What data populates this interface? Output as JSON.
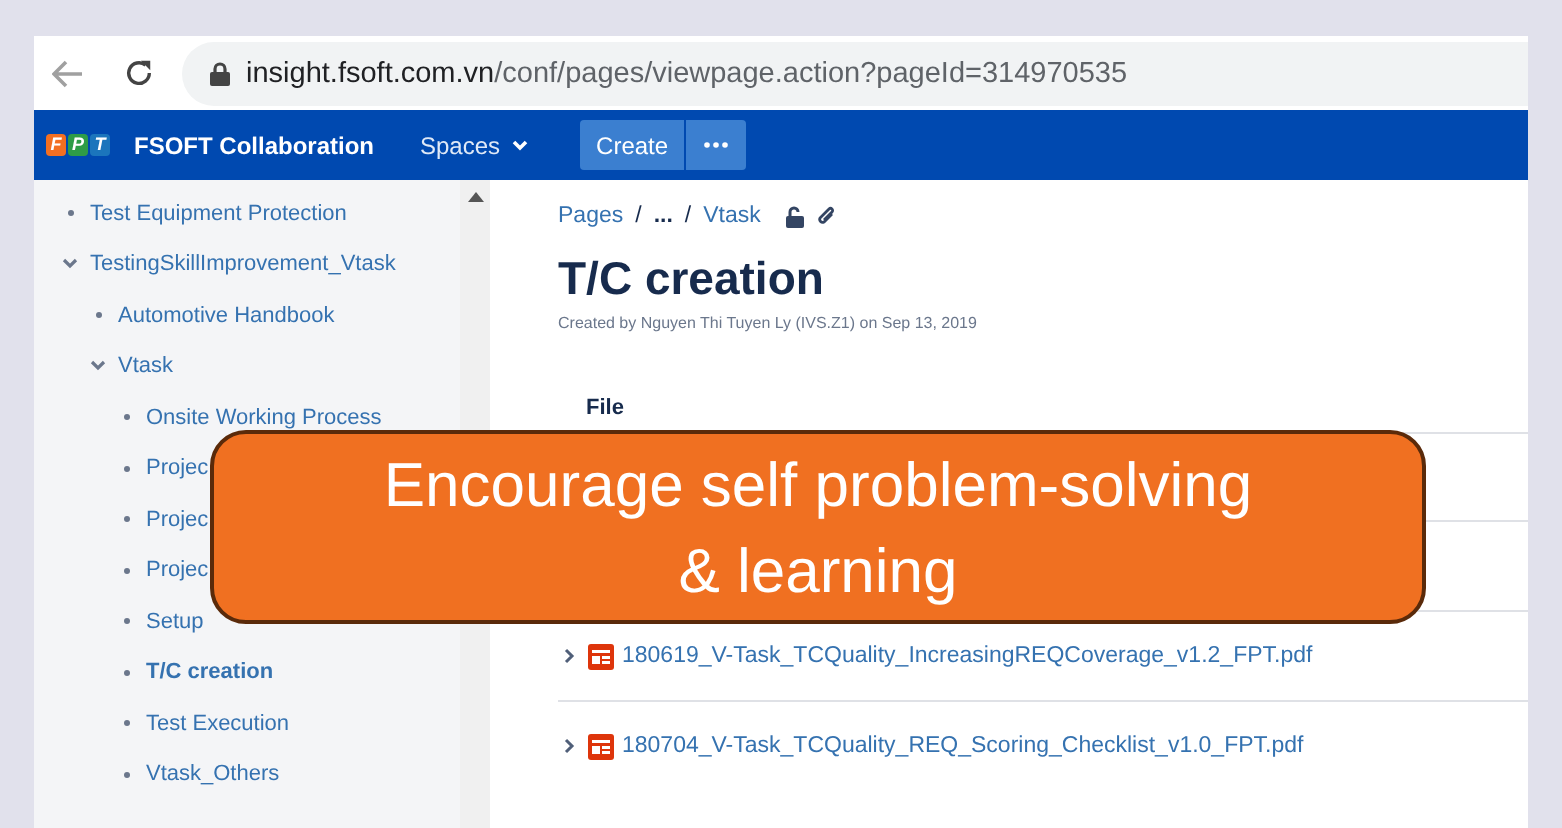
{
  "address_bar": {
    "host": "insight.fsoft.com.vn",
    "path": "/conf/pages/viewpage.action?pageId=314970535"
  },
  "navbar": {
    "logo": [
      "F",
      "P",
      "T"
    ],
    "site_title": "FSOFT Collaboration",
    "spaces_menu": "Spaces",
    "create_button": "Create"
  },
  "sidebar": {
    "items": [
      {
        "label": "Test Equipment Protection",
        "selected": false
      },
      {
        "label": "TestingSkillImprovement_Vtask",
        "selected": false,
        "expanded": true,
        "children": [
          {
            "label": "Automotive Handbook",
            "selected": false
          },
          {
            "label": "Vtask",
            "selected": false,
            "expanded": true,
            "children": [
              {
                "label": "Onsite Working Process",
                "selected": false
              },
              {
                "label": "Projec",
                "selected": false
              },
              {
                "label": "Projec",
                "selected": false
              },
              {
                "label": "Projec",
                "selected": false
              },
              {
                "label": "Setup",
                "selected": false
              },
              {
                "label": "T/C creation",
                "selected": true
              },
              {
                "label": "Test Execution",
                "selected": false
              },
              {
                "label": "Vtask_Others",
                "selected": false
              }
            ]
          }
        ]
      }
    ]
  },
  "content": {
    "breadcrumb": [
      {
        "kind": "link",
        "text": "Pages"
      },
      {
        "kind": "separator",
        "text": "/"
      },
      {
        "kind": "ellipsis",
        "text": "..."
      },
      {
        "kind": "separator",
        "text": "/"
      },
      {
        "kind": "link",
        "text": "Vtask"
      }
    ],
    "title": "T/C creation",
    "byline": "Created by Nguyen Thi Tuyen Ly (IVS.Z1) on Sep 13, 2019",
    "table": {
      "columns": [
        "File"
      ],
      "rows": [
        {
          "file": "180619_V-Task_TCQuality_IncreasingREQCoverage_v1.2_FPT.pdf"
        },
        {
          "file": "180704_V-Task_TCQuality_REQ_Scoring_Checklist_v1.0_FPT.pdf"
        }
      ]
    }
  },
  "callout": {
    "text": "Encourage self problem-solving\n& learning"
  }
}
